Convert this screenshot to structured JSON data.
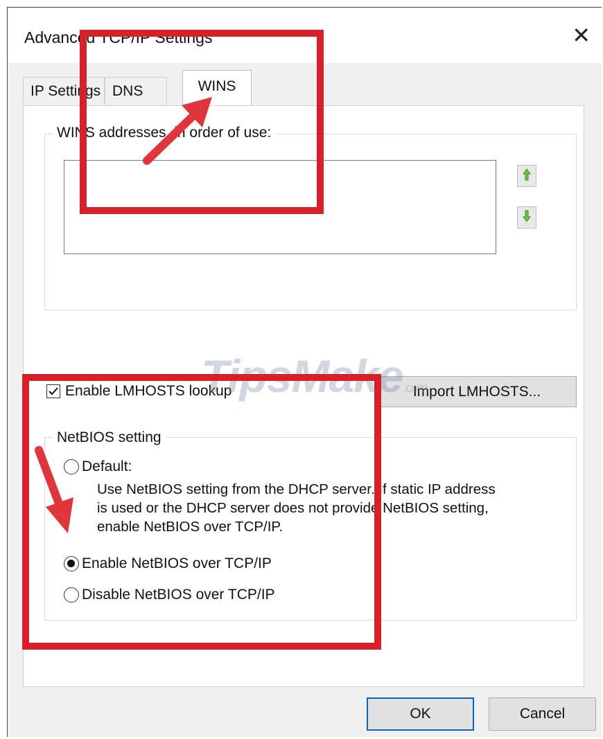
{
  "dialog": {
    "title": "Advanced TCP/IP Settings",
    "close_glyph": "✕"
  },
  "tabs": [
    {
      "label": "IP Settings",
      "active": false
    },
    {
      "label": "DNS",
      "active": false
    },
    {
      "label": "WINS",
      "active": true
    }
  ],
  "wins": {
    "group_label": "WINS addresses, in order of use:",
    "addresses": [],
    "move_up_icon": "green-up-arrow-icon",
    "move_down_icon": "green-down-arrow-icon"
  },
  "lmhosts": {
    "checkbox_label": "Enable LMHOSTS lookup",
    "checked": true,
    "import_button": "Import LMHOSTS..."
  },
  "netbios": {
    "group_label": "NetBIOS setting",
    "selected": "enable",
    "options": [
      {
        "id": "default",
        "label": "Default:"
      },
      {
        "id": "enable",
        "label": "Enable NetBIOS over TCP/IP"
      },
      {
        "id": "disable",
        "label": "Disable NetBIOS over TCP/IP"
      }
    ],
    "default_description": [
      "Use NetBIOS setting from the DHCP server. If static IP address",
      "is used or the DHCP server does not provide NetBIOS setting,",
      "enable NetBIOS over TCP/IP."
    ]
  },
  "footer": {
    "ok_label": "OK",
    "cancel_label": "Cancel"
  },
  "annotations": {
    "highlight_color": "#d8202a",
    "watermark_text": "TipsMake",
    "watermark_suffix": ".com"
  }
}
